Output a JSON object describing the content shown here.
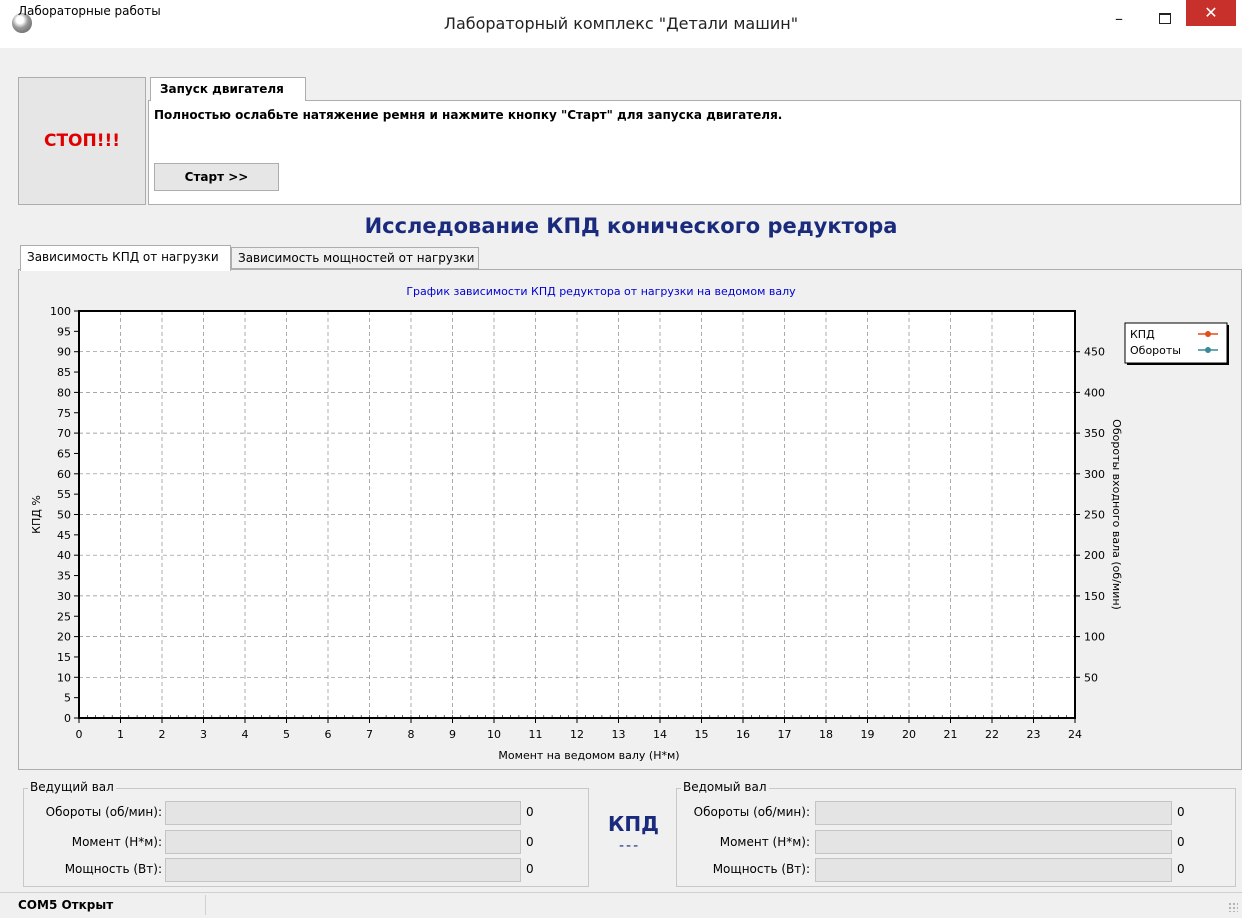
{
  "window": {
    "title": "Лабораторный комплекс \"Детали машин\"",
    "min_label": "–",
    "close_label": "✕"
  },
  "menu": {
    "items": [
      "Лабораторные работы"
    ]
  },
  "stop_button": {
    "label": "СТОП!!!",
    "color": "#e00000"
  },
  "launch": {
    "tab_label": "Запуск двигателя",
    "instruction": "Полностью ослабьте натяжение ремня и нажмите кнопку \"Старт\" для запуска двигателя.",
    "start_label": "Старт >>"
  },
  "heading": "Исследование КПД конического редуктора",
  "chart_tabs": [
    "Зависимость КПД от нагрузки",
    "Зависимость мощностей от нагрузки"
  ],
  "chart_data": {
    "type": "line",
    "title": "График зависимости КПД редуктора от нагрузки на ведомом валу",
    "xlabel": "Момент на ведомом валу (Н*м)",
    "ylabel": "КПД %",
    "y2label": "Обороты входного вала (об/мин)",
    "xlim": [
      0,
      24
    ],
    "ylim": [
      0,
      100
    ],
    "y2lim": [
      0,
      500
    ],
    "x_ticks": [
      0,
      1,
      2,
      3,
      4,
      5,
      6,
      7,
      8,
      9,
      10,
      11,
      12,
      13,
      14,
      15,
      16,
      17,
      18,
      19,
      20,
      21,
      22,
      23,
      24
    ],
    "y_ticks": [
      0,
      5,
      10,
      15,
      20,
      25,
      30,
      35,
      40,
      45,
      50,
      55,
      60,
      65,
      70,
      75,
      80,
      85,
      90,
      95,
      100
    ],
    "y2_ticks": [
      50,
      100,
      150,
      200,
      250,
      300,
      350,
      400,
      450
    ],
    "grid": true,
    "legend_position": "top-right",
    "series": [
      {
        "name": "КПД",
        "color": "#e0501a",
        "values": []
      },
      {
        "name": "Обороты",
        "color": "#3a8a9a",
        "values": []
      }
    ]
  },
  "driving_shaft": {
    "title": "Ведущий вал",
    "rows": [
      {
        "label": "Обороты (об/мин):",
        "value": "0"
      },
      {
        "label": "Момент (Н*м):",
        "value": "0"
      },
      {
        "label": "Мощность (Вт):",
        "value": "0"
      }
    ]
  },
  "kpd": {
    "title": "КПД",
    "value": "---"
  },
  "driven_shaft": {
    "title": "Ведомый вал",
    "rows": [
      {
        "label": "Обороты (об/мин):",
        "value": "0"
      },
      {
        "label": "Момент (Н*м):",
        "value": "0"
      },
      {
        "label": "Мощность (Вт):",
        "value": "0"
      }
    ]
  },
  "status": {
    "text": "COM5 Открыт"
  }
}
